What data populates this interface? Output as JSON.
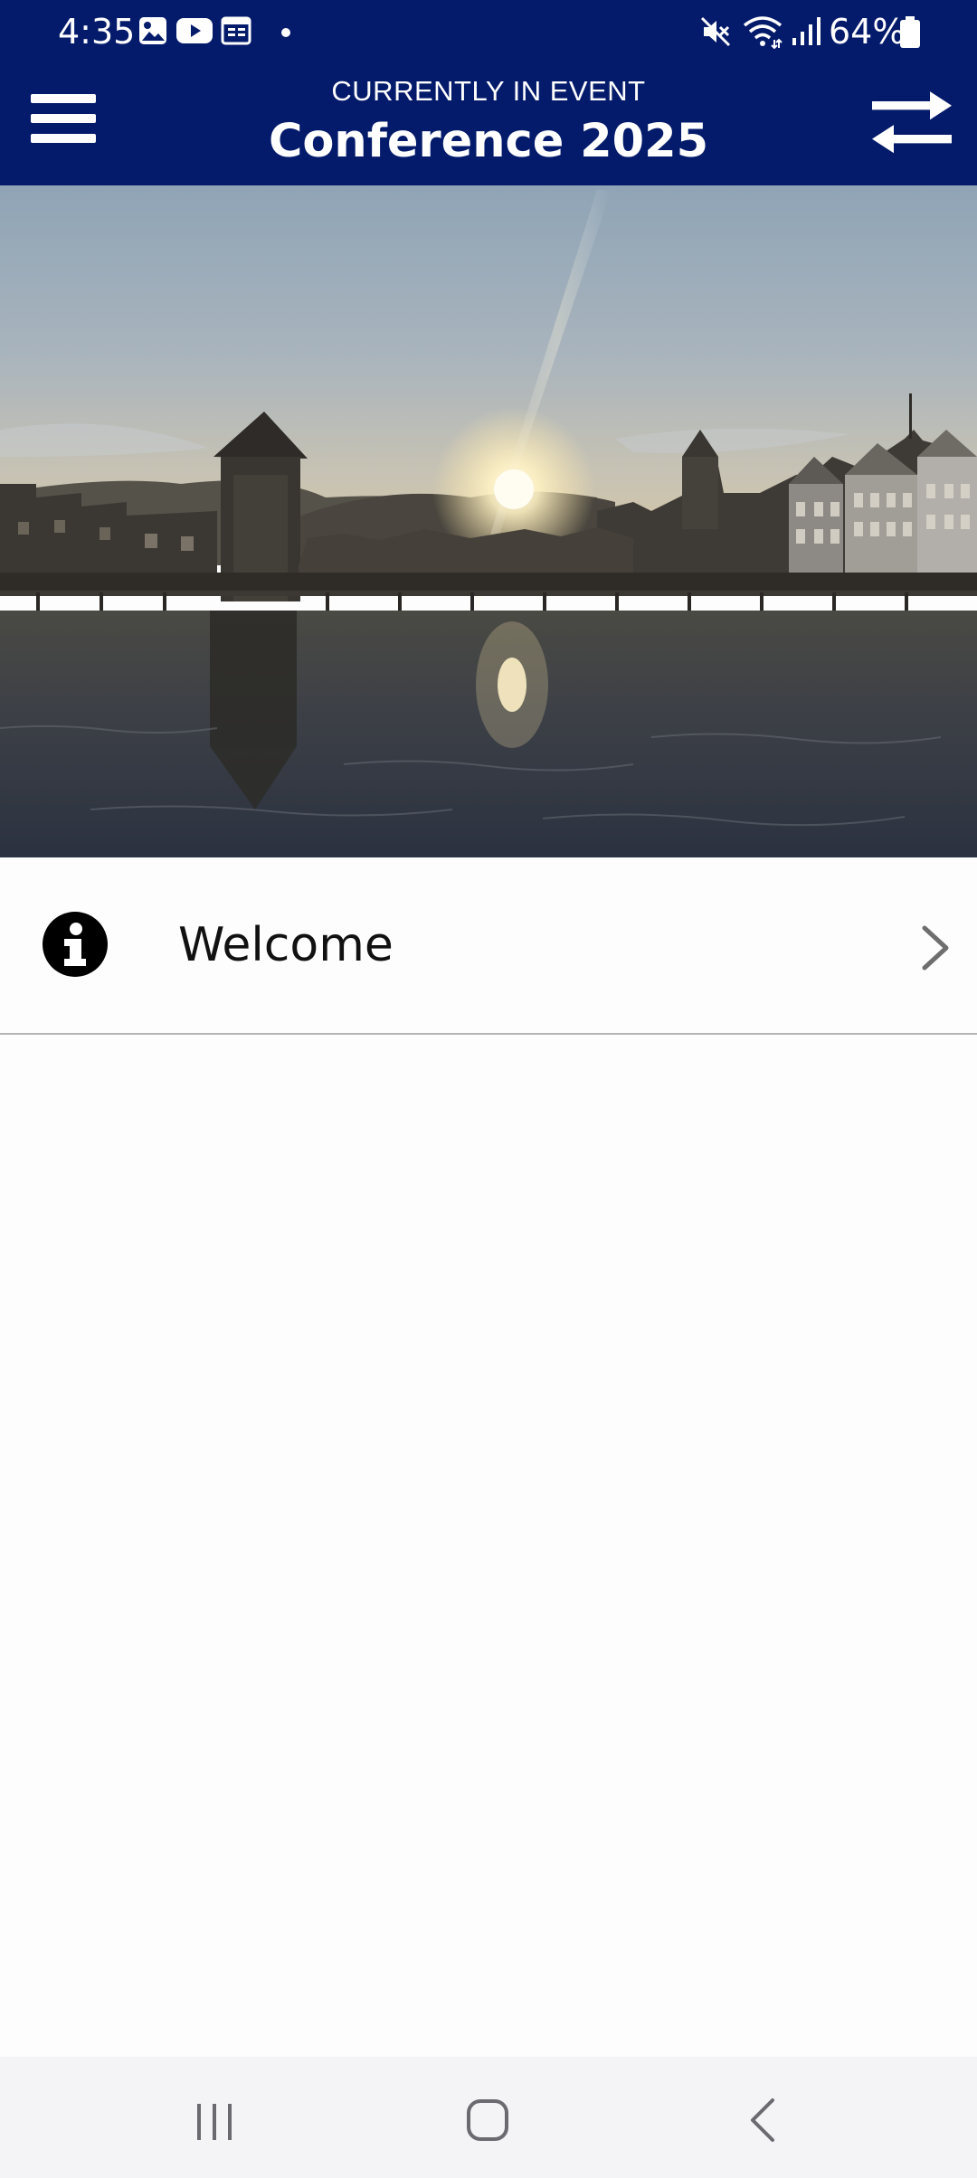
{
  "status_bar": {
    "time": "4:35",
    "battery_percent": "64%",
    "left_icons": [
      "gallery-icon",
      "youtube-icon",
      "calendar-icon",
      "dot-icon"
    ],
    "right_icons": [
      "mute-icon",
      "wifi-icon",
      "signal-icon",
      "battery-icon"
    ]
  },
  "header": {
    "subtitle": "CURRENTLY IN EVENT",
    "title": "Conference 2025",
    "background_color": "#041b6b",
    "menu_icon": "hamburger-menu-icon",
    "switch_icon": "swap-arrows-icon"
  },
  "hero": {
    "image_icon": "event-hero-image"
  },
  "menu_items": [
    {
      "label": "Welcome",
      "icon": "info-icon",
      "trailing_icon": "chevron-right-icon"
    }
  ],
  "nav_bar": {
    "buttons": [
      "recent-apps-icon",
      "home-icon",
      "back-icon"
    ]
  }
}
